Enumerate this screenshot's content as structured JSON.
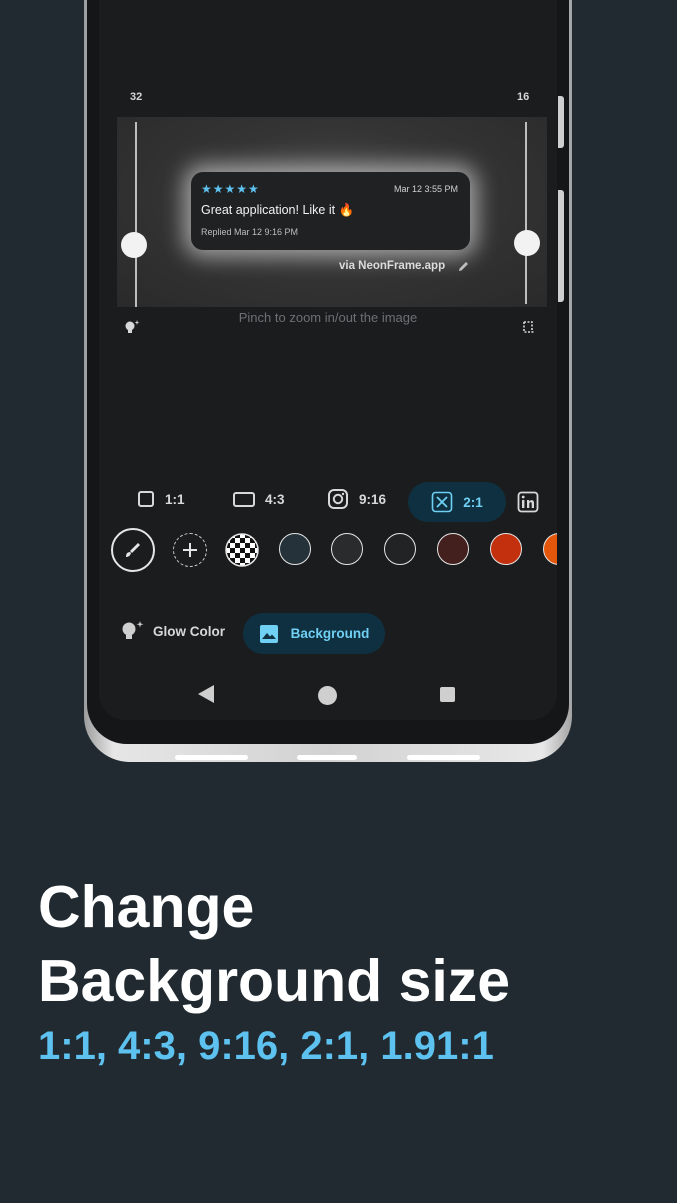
{
  "editor": {
    "left_scale_value": "32",
    "right_scale_value": "16",
    "preview_card": {
      "stars": "★★★★★",
      "date": "Mar 12 3:55 PM",
      "message": "Great application! Like it 🔥",
      "reply": "Replied Mar 12 9:16 PM"
    },
    "watermark": "via NeonFrame.app",
    "hint": "Pinch to zoom in/out the image",
    "ratios": [
      {
        "label": "1:1",
        "icon": "square-icon"
      },
      {
        "label": "4:3",
        "icon": "rectangle-icon"
      },
      {
        "label": "9:16",
        "icon": "instagram-icon"
      },
      {
        "label": "2:1",
        "icon": "x-logo-icon",
        "selected": true
      }
    ],
    "swatch_colors": [
      "#26323a",
      "#2a2b2c",
      "#222324",
      "#43201e",
      "#c2300e",
      "#e4560a"
    ],
    "tabs": {
      "glow_label": "Glow Color",
      "background_label": "Background",
      "selected": "Background"
    }
  },
  "headline": {
    "line1": "Change",
    "line2": "Background size",
    "subtitle": "1:1, 4:3, 9:16, 2:1, 1.91:1"
  },
  "colors": {
    "page_background": "#202a30",
    "accent": "#5ec2f0",
    "selected_chip_background": "#0f3040"
  }
}
